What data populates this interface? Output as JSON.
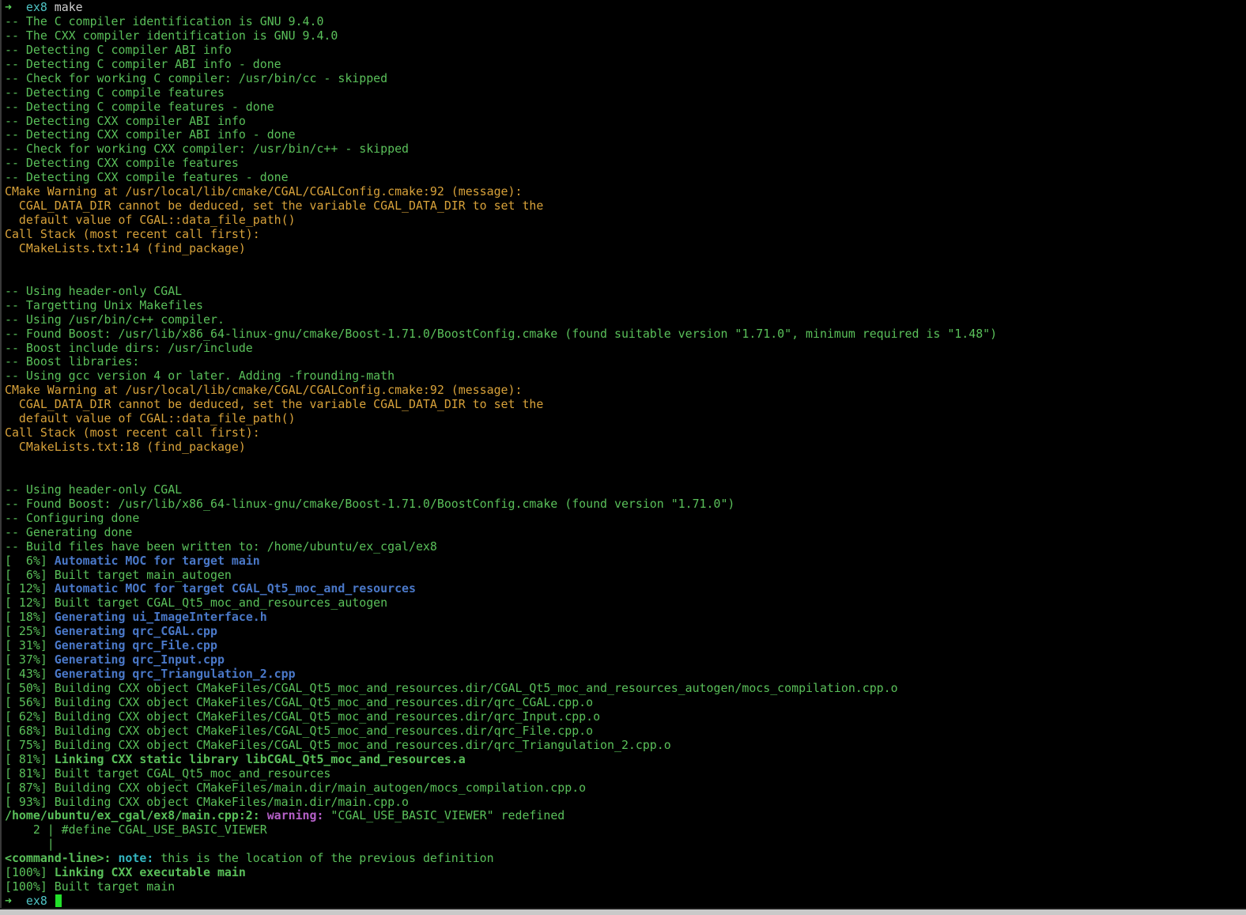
{
  "terminal": {
    "colors": {
      "background": "#000000",
      "prompt_arrow": "#5ad35a",
      "prompt_dir": "#4ec3c3",
      "plain": "#d0d0d0",
      "green": "#5ac05a",
      "orange": "#d8a23a",
      "blue": "#4a78c8",
      "purple": "#b560c8",
      "cyan": "#33b6c0",
      "cursor": "#22e02a"
    },
    "lines": [
      {
        "segments": [
          {
            "text": "➜  ",
            "color": "prompt_arrow",
            "bold": true
          },
          {
            "text": "ex8",
            "color": "prompt_dir"
          },
          {
            "text": " make",
            "color": "plain"
          }
        ]
      },
      {
        "segments": [
          {
            "text": "-- The C compiler identification is GNU 9.4.0",
            "color": "green"
          }
        ]
      },
      {
        "segments": [
          {
            "text": "-- The CXX compiler identification is GNU 9.4.0",
            "color": "green"
          }
        ]
      },
      {
        "segments": [
          {
            "text": "-- Detecting C compiler ABI info",
            "color": "green"
          }
        ]
      },
      {
        "segments": [
          {
            "text": "-- Detecting C compiler ABI info - done",
            "color": "green"
          }
        ]
      },
      {
        "segments": [
          {
            "text": "-- Check for working C compiler: /usr/bin/cc - skipped",
            "color": "green"
          }
        ]
      },
      {
        "segments": [
          {
            "text": "-- Detecting C compile features",
            "color": "green"
          }
        ]
      },
      {
        "segments": [
          {
            "text": "-- Detecting C compile features - done",
            "color": "green"
          }
        ]
      },
      {
        "segments": [
          {
            "text": "-- Detecting CXX compiler ABI info",
            "color": "green"
          }
        ]
      },
      {
        "segments": [
          {
            "text": "-- Detecting CXX compiler ABI info - done",
            "color": "green"
          }
        ]
      },
      {
        "segments": [
          {
            "text": "-- Check for working CXX compiler: /usr/bin/c++ - skipped",
            "color": "green"
          }
        ]
      },
      {
        "segments": [
          {
            "text": "-- Detecting CXX compile features",
            "color": "green"
          }
        ]
      },
      {
        "segments": [
          {
            "text": "-- Detecting CXX compile features - done",
            "color": "green"
          }
        ]
      },
      {
        "segments": [
          {
            "text": "CMake Warning at /usr/local/lib/cmake/CGAL/CGALConfig.cmake:92 (message):",
            "color": "orange"
          }
        ]
      },
      {
        "segments": [
          {
            "text": "  CGAL_DATA_DIR cannot be deduced, set the variable CGAL_DATA_DIR to set the",
            "color": "orange"
          }
        ]
      },
      {
        "segments": [
          {
            "text": "  default value of CGAL::data_file_path()",
            "color": "orange"
          }
        ]
      },
      {
        "segments": [
          {
            "text": "Call Stack (most recent call first):",
            "color": "orange"
          }
        ]
      },
      {
        "segments": [
          {
            "text": "  CMakeLists.txt:14 (find_package)",
            "color": "orange"
          }
        ]
      },
      {
        "segments": [
          {
            "text": "",
            "color": "plain"
          }
        ]
      },
      {
        "segments": [
          {
            "text": "",
            "color": "plain"
          }
        ]
      },
      {
        "segments": [
          {
            "text": "-- Using header-only CGAL",
            "color": "green"
          }
        ]
      },
      {
        "segments": [
          {
            "text": "-- Targetting Unix Makefiles",
            "color": "green"
          }
        ]
      },
      {
        "segments": [
          {
            "text": "-- Using /usr/bin/c++ compiler.",
            "color": "green"
          }
        ]
      },
      {
        "segments": [
          {
            "text": "-- Found Boost: /usr/lib/x86_64-linux-gnu/cmake/Boost-1.71.0/BoostConfig.cmake (found suitable version \"1.71.0\", minimum required is \"1.48\")",
            "color": "green"
          }
        ]
      },
      {
        "segments": [
          {
            "text": "-- Boost include dirs: /usr/include",
            "color": "green"
          }
        ]
      },
      {
        "segments": [
          {
            "text": "-- Boost libraries:",
            "color": "green"
          }
        ]
      },
      {
        "segments": [
          {
            "text": "-- Using gcc version 4 or later. Adding -frounding-math",
            "color": "green"
          }
        ]
      },
      {
        "segments": [
          {
            "text": "CMake Warning at /usr/local/lib/cmake/CGAL/CGALConfig.cmake:92 (message):",
            "color": "orange"
          }
        ]
      },
      {
        "segments": [
          {
            "text": "  CGAL_DATA_DIR cannot be deduced, set the variable CGAL_DATA_DIR to set the",
            "color": "orange"
          }
        ]
      },
      {
        "segments": [
          {
            "text": "  default value of CGAL::data_file_path()",
            "color": "orange"
          }
        ]
      },
      {
        "segments": [
          {
            "text": "Call Stack (most recent call first):",
            "color": "orange"
          }
        ]
      },
      {
        "segments": [
          {
            "text": "  CMakeLists.txt:18 (find_package)",
            "color": "orange"
          }
        ]
      },
      {
        "segments": [
          {
            "text": "",
            "color": "plain"
          }
        ]
      },
      {
        "segments": [
          {
            "text": "",
            "color": "plain"
          }
        ]
      },
      {
        "segments": [
          {
            "text": "-- Using header-only CGAL",
            "color": "green"
          }
        ]
      },
      {
        "segments": [
          {
            "text": "-- Found Boost: /usr/lib/x86_64-linux-gnu/cmake/Boost-1.71.0/BoostConfig.cmake (found version \"1.71.0\")",
            "color": "green"
          }
        ]
      },
      {
        "segments": [
          {
            "text": "-- Configuring done",
            "color": "green"
          }
        ]
      },
      {
        "segments": [
          {
            "text": "-- Generating done",
            "color": "green"
          }
        ]
      },
      {
        "segments": [
          {
            "text": "-- Build files have been written to: /home/ubuntu/ex_cgal/ex8",
            "color": "green"
          }
        ]
      },
      {
        "segments": [
          {
            "text": "[  6%] ",
            "color": "green"
          },
          {
            "text": "Automatic MOC for target main",
            "color": "blue",
            "bold": true
          }
        ]
      },
      {
        "segments": [
          {
            "text": "[  6%] Built target main_autogen",
            "color": "green"
          }
        ]
      },
      {
        "segments": [
          {
            "text": "[ 12%] ",
            "color": "green"
          },
          {
            "text": "Automatic MOC for target CGAL_Qt5_moc_and_resources",
            "color": "blue",
            "bold": true
          }
        ]
      },
      {
        "segments": [
          {
            "text": "[ 12%] Built target CGAL_Qt5_moc_and_resources_autogen",
            "color": "green"
          }
        ]
      },
      {
        "segments": [
          {
            "text": "[ 18%] ",
            "color": "green"
          },
          {
            "text": "Generating ui_ImageInterface.h",
            "color": "blue",
            "bold": true
          }
        ]
      },
      {
        "segments": [
          {
            "text": "[ 25%] ",
            "color": "green"
          },
          {
            "text": "Generating qrc_CGAL.cpp",
            "color": "blue",
            "bold": true
          }
        ]
      },
      {
        "segments": [
          {
            "text": "[ 31%] ",
            "color": "green"
          },
          {
            "text": "Generating qrc_File.cpp",
            "color": "blue",
            "bold": true
          }
        ]
      },
      {
        "segments": [
          {
            "text": "[ 37%] ",
            "color": "green"
          },
          {
            "text": "Generating qrc_Input.cpp",
            "color": "blue",
            "bold": true
          }
        ]
      },
      {
        "segments": [
          {
            "text": "[ 43%] ",
            "color": "green"
          },
          {
            "text": "Generating qrc_Triangulation_2.cpp",
            "color": "blue",
            "bold": true
          }
        ]
      },
      {
        "segments": [
          {
            "text": "[ 50%] Building CXX object CMakeFiles/CGAL_Qt5_moc_and_resources.dir/CGAL_Qt5_moc_and_resources_autogen/mocs_compilation.cpp.o",
            "color": "green"
          }
        ]
      },
      {
        "segments": [
          {
            "text": "[ 56%] Building CXX object CMakeFiles/CGAL_Qt5_moc_and_resources.dir/qrc_CGAL.cpp.o",
            "color": "green"
          }
        ]
      },
      {
        "segments": [
          {
            "text": "[ 62%] Building CXX object CMakeFiles/CGAL_Qt5_moc_and_resources.dir/qrc_Input.cpp.o",
            "color": "green"
          }
        ]
      },
      {
        "segments": [
          {
            "text": "[ 68%] Building CXX object CMakeFiles/CGAL_Qt5_moc_and_resources.dir/qrc_File.cpp.o",
            "color": "green"
          }
        ]
      },
      {
        "segments": [
          {
            "text": "[ 75%] Building CXX object CMakeFiles/CGAL_Qt5_moc_and_resources.dir/qrc_Triangulation_2.cpp.o",
            "color": "green"
          }
        ]
      },
      {
        "segments": [
          {
            "text": "[ 81%] ",
            "color": "green"
          },
          {
            "text": "Linking CXX static library libCGAL_Qt5_moc_and_resources.a",
            "color": "green",
            "bold": true
          }
        ]
      },
      {
        "segments": [
          {
            "text": "[ 81%] Built target CGAL_Qt5_moc_and_resources",
            "color": "green"
          }
        ]
      },
      {
        "segments": [
          {
            "text": "[ 87%] Building CXX object CMakeFiles/main.dir/main_autogen/mocs_compilation.cpp.o",
            "color": "green"
          }
        ]
      },
      {
        "segments": [
          {
            "text": "[ 93%] Building CXX object CMakeFiles/main.dir/main.cpp.o",
            "color": "green"
          }
        ]
      },
      {
        "segments": [
          {
            "text": "/home/ubuntu/ex_cgal/ex8/main.cpp:2:",
            "color": "green",
            "bold": true
          },
          {
            "text": " ",
            "color": "plain"
          },
          {
            "text": "warning:",
            "color": "purple",
            "bold": true
          },
          {
            "text": " \"CGAL_USE_BASIC_VIEWER\" redefined",
            "color": "green"
          }
        ]
      },
      {
        "segments": [
          {
            "text": "    2 | #define CGAL_USE_BASIC_VIEWER",
            "color": "green"
          }
        ]
      },
      {
        "segments": [
          {
            "text": "      |",
            "color": "green"
          }
        ]
      },
      {
        "segments": [
          {
            "text": "<command-line>:",
            "color": "green",
            "bold": true
          },
          {
            "text": " ",
            "color": "plain"
          },
          {
            "text": "note:",
            "color": "cyan",
            "bold": true
          },
          {
            "text": " this is the location of the previous definition",
            "color": "green"
          }
        ]
      },
      {
        "segments": [
          {
            "text": "[100%] ",
            "color": "green"
          },
          {
            "text": "Linking CXX executable main",
            "color": "green",
            "bold": true
          }
        ]
      },
      {
        "segments": [
          {
            "text": "[100%] Built target main",
            "color": "green"
          }
        ]
      },
      {
        "segments": [
          {
            "text": "➜  ",
            "color": "prompt_arrow",
            "bold": true
          },
          {
            "text": "ex8",
            "color": "prompt_dir"
          },
          {
            "text": " ",
            "color": "plain"
          }
        ],
        "cursor": true
      }
    ]
  }
}
